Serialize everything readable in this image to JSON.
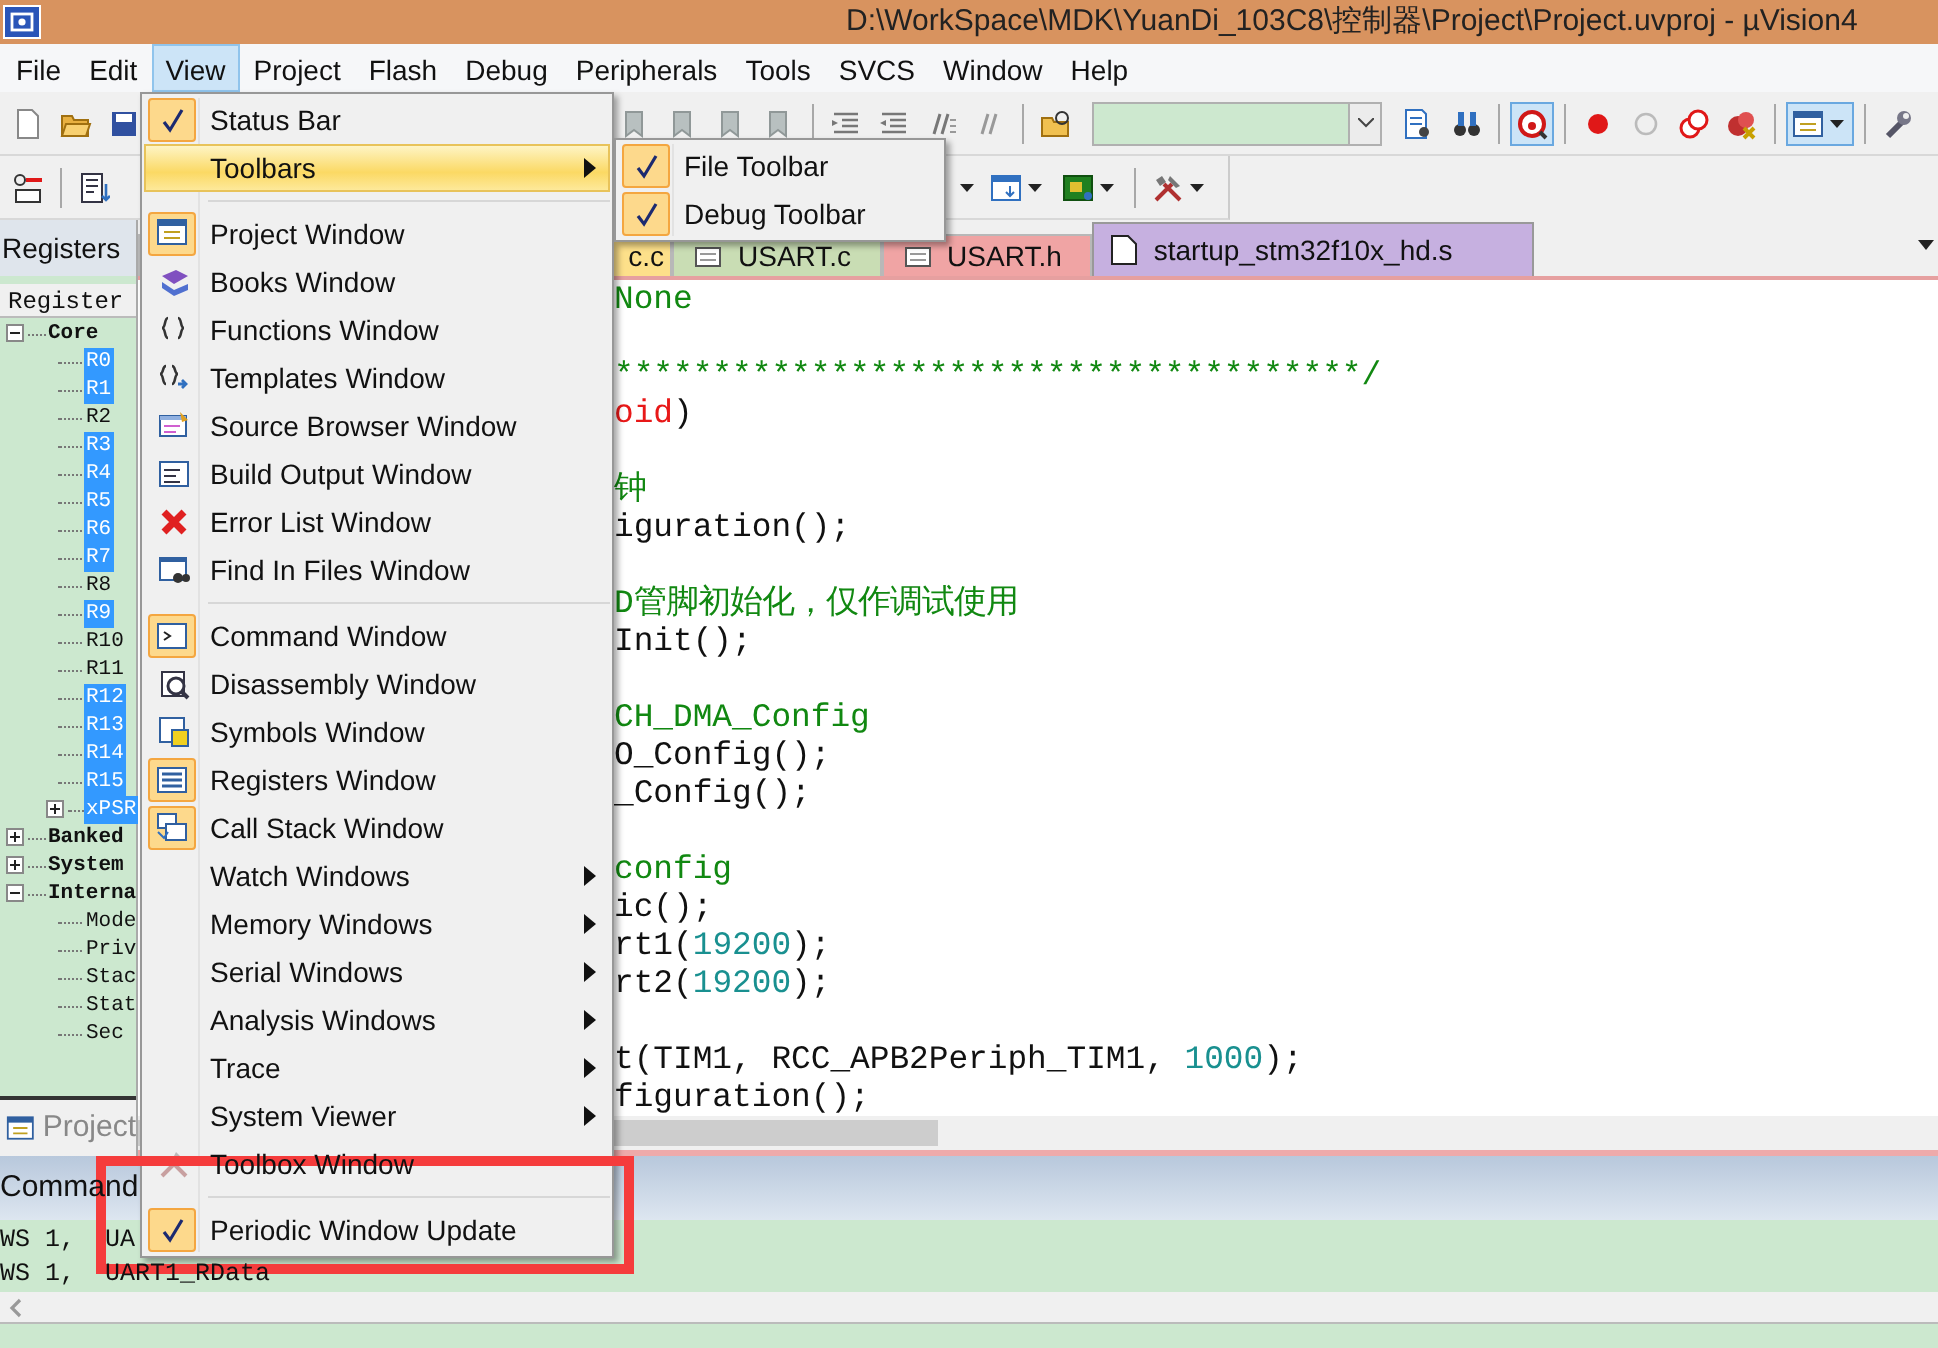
{
  "window": {
    "title": "D:\\WorkSpace\\MDK\\YuanDi_103C8\\控制器\\Project\\Project.uvproj - µVision4"
  },
  "menu_bar": [
    {
      "label": "File",
      "selected": false
    },
    {
      "label": "Edit",
      "selected": false
    },
    {
      "label": "View",
      "selected": true
    },
    {
      "label": "Project",
      "selected": false
    },
    {
      "label": "Flash",
      "selected": false
    },
    {
      "label": "Debug",
      "selected": false
    },
    {
      "label": "Peripherals",
      "selected": false
    },
    {
      "label": "Tools",
      "selected": false
    },
    {
      "label": "SVCS",
      "selected": false
    },
    {
      "label": "Window",
      "selected": false
    },
    {
      "label": "Help",
      "selected": false
    }
  ],
  "toolbars": [
    {
      "buttons": [
        {
          "pressed": false
        },
        {
          "pressed": false
        },
        {
          "pressed": false
        },
        {
          "pressed": false
        },
        {
          "pressed": false
        },
        {
          "pressed": false
        },
        {
          "pressed": false
        },
        {
          "pressed": false
        },
        {
          "pressed": false
        },
        {
          "pressed": false
        },
        {
          "pressed": false
        },
        {
          "pressed": false
        },
        {
          "pressed": false
        },
        {
          "pressed": false
        },
        {
          "pressed": true
        },
        {
          "pressed": false
        },
        {
          "pressed": false
        },
        {
          "pressed": false
        },
        {
          "pressed": false
        },
        {
          "pressed": true
        },
        {
          "pressed": false
        }
      ]
    },
    {
      "buttons": [
        {
          "pressed": false
        },
        {
          "pressed": false
        },
        {
          "pressed": false
        },
        {
          "pressed": false
        },
        {
          "pressed": false
        },
        {
          "pressed": false
        }
      ]
    }
  ],
  "registers_panel": {
    "title": "Registers",
    "column": "Register",
    "tree": [
      {
        "label": "Core",
        "expanded": true,
        "selected": false,
        "children": [
          {
            "label": "R0",
            "selected": true
          },
          {
            "label": "R1",
            "selected": true
          },
          {
            "label": "R2",
            "selected": false
          },
          {
            "label": "R3",
            "selected": true
          },
          {
            "label": "R4",
            "selected": true
          },
          {
            "label": "R5",
            "selected": true
          },
          {
            "label": "R6",
            "selected": true
          },
          {
            "label": "R7",
            "selected": true
          },
          {
            "label": "R8",
            "selected": false
          },
          {
            "label": "R9",
            "selected": true
          },
          {
            "label": "R10",
            "selected": false
          },
          {
            "label": "R11",
            "selected": false
          },
          {
            "label": "R12",
            "selected": true
          },
          {
            "label": "R13",
            "selected": true
          },
          {
            "label": "R14",
            "selected": true
          },
          {
            "label": "R15",
            "selected": true
          },
          {
            "label": "xPSR",
            "selected": true,
            "expanded": false
          }
        ]
      },
      {
        "label": "Banked",
        "expanded": false,
        "selected": false
      },
      {
        "label": "System",
        "expanded": false,
        "selected": false
      },
      {
        "label": "Interna",
        "expanded": true,
        "selected": false,
        "children": [
          {
            "label": "Mode",
            "selected": false
          },
          {
            "label": "Priv",
            "selected": false
          },
          {
            "label": "Stac",
            "selected": false
          },
          {
            "label": "Stat",
            "selected": false
          },
          {
            "label": "Sec",
            "selected": false
          }
        ]
      }
    ],
    "bottom_tab": "Project"
  },
  "editor_tabs": [
    {
      "label": "c.c",
      "color": "#fde08a",
      "selected": false
    },
    {
      "label": "USART.c",
      "color": "#c9ddb4",
      "selected": false
    },
    {
      "label": "USART.h",
      "color": "#f0a4a4",
      "selected": false
    },
    {
      "label": "startup_stm32f10x_hd.s",
      "color": "#c6b0e0",
      "selected": true
    }
  ],
  "code_lines": [
    {
      "blank_before": false,
      "segments": [
        {
          "text": "None",
          "kind": "comment"
        }
      ]
    },
    {
      "blank_before": true,
      "segments": [
        {
          "text": "**************************************/",
          "kind": "comment"
        }
      ]
    },
    {
      "blank_before": false,
      "segments": [
        {
          "text": "oid",
          "kind": "keyword"
        },
        {
          "text": ")",
          "kind": "plain"
        }
      ]
    },
    {
      "blank_before": true,
      "segments": [
        {
          "text": "钟",
          "kind": "comment"
        }
      ]
    },
    {
      "blank_before": false,
      "segments": [
        {
          "text": "iguration();",
          "kind": "plain"
        }
      ]
    },
    {
      "blank_before": true,
      "segments": [
        {
          "text": "D管脚初始化，仅作调试使用",
          "kind": "comment"
        }
      ]
    },
    {
      "blank_before": false,
      "segments": [
        {
          "text": "Init();",
          "kind": "plain"
        }
      ]
    },
    {
      "blank_before": true,
      "segments": [
        {
          "text": "CH_DMA_Config",
          "kind": "comment"
        }
      ]
    },
    {
      "blank_before": false,
      "segments": [
        {
          "text": "O_Config();",
          "kind": "plain"
        }
      ]
    },
    {
      "blank_before": false,
      "segments": [
        {
          "text": "_Config();",
          "kind": "plain"
        }
      ]
    },
    {
      "blank_before": true,
      "segments": [
        {
          "text": "config",
          "kind": "comment"
        }
      ]
    },
    {
      "blank_before": false,
      "segments": [
        {
          "text": "ic();",
          "kind": "plain"
        }
      ]
    },
    {
      "blank_before": false,
      "segments": [
        {
          "text": "rt1(",
          "kind": "plain"
        },
        {
          "text": "19200",
          "kind": "number"
        },
        {
          "text": ");",
          "kind": "plain"
        }
      ]
    },
    {
      "blank_before": false,
      "segments": [
        {
          "text": "rt2(",
          "kind": "plain"
        },
        {
          "text": "19200",
          "kind": "number"
        },
        {
          "text": ");",
          "kind": "plain"
        }
      ]
    },
    {
      "blank_before": true,
      "segments": [
        {
          "text": "t(TIM1, RCC_APB2Periph_TIM1, ",
          "kind": "plain"
        },
        {
          "text": "1000",
          "kind": "number"
        },
        {
          "text": ");",
          "kind": "plain"
        }
      ]
    },
    {
      "blank_before": false,
      "segments": [
        {
          "text": "figuration();",
          "kind": "plain"
        }
      ]
    }
  ],
  "command_panel": {
    "title": "Command",
    "lines": [
      "WS 1,  UA",
      "WS 1,  UART1_RData"
    ]
  },
  "view_menu": [
    {
      "label": "Status Bar",
      "kind": "check",
      "checked": true,
      "selected": false
    },
    {
      "label": "Toolbars",
      "kind": "submenu",
      "selected": true
    },
    {
      "kind": "separator"
    },
    {
      "label": "Project Window",
      "kind": "icon",
      "active": true,
      "selected": false
    },
    {
      "label": "Books Window",
      "kind": "icon",
      "active": false,
      "selected": false
    },
    {
      "label": "Functions Window",
      "kind": "icon",
      "active": false,
      "selected": false
    },
    {
      "label": "Templates Window",
      "kind": "icon",
      "active": false,
      "selected": false
    },
    {
      "label": "Source Browser Window",
      "kind": "icon",
      "active": false,
      "selected": false
    },
    {
      "label": "Build Output Window",
      "kind": "icon",
      "active": false,
      "selected": false
    },
    {
      "label": "Error List Window",
      "kind": "icon",
      "active": false,
      "selected": false
    },
    {
      "label": "Find In Files Window",
      "kind": "icon",
      "active": false,
      "selected": false
    },
    {
      "kind": "separator"
    },
    {
      "label": "Command Window",
      "kind": "icon",
      "active": true,
      "selected": false
    },
    {
      "label": "Disassembly Window",
      "kind": "icon",
      "active": false,
      "selected": false
    },
    {
      "label": "Symbols Window",
      "kind": "icon",
      "active": false,
      "selected": false
    },
    {
      "label": "Registers Window",
      "kind": "icon",
      "active": true,
      "selected": false
    },
    {
      "label": "Call Stack Window",
      "kind": "icon",
      "active": true,
      "selected": false
    },
    {
      "label": "Watch Windows",
      "kind": "submenu",
      "selected": false
    },
    {
      "label": "Memory Windows",
      "kind": "submenu",
      "selected": false
    },
    {
      "label": "Serial Windows",
      "kind": "submenu",
      "selected": false
    },
    {
      "label": "Analysis Windows",
      "kind": "submenu",
      "selected": false
    },
    {
      "label": "Trace",
      "kind": "submenu",
      "selected": false
    },
    {
      "label": "System Viewer",
      "kind": "submenu",
      "selected": false
    },
    {
      "label": "Toolbox Window",
      "kind": "icon",
      "active": false,
      "selected": false
    },
    {
      "kind": "separator"
    },
    {
      "label": "Periodic Window Update",
      "kind": "check",
      "checked": true,
      "selected": false
    }
  ],
  "toolbars_submenu": [
    {
      "label": "File Toolbar",
      "checked": true,
      "selected": false
    },
    {
      "label": "Debug Toolbar",
      "checked": true,
      "selected": false
    }
  ],
  "annotations": [
    {
      "kind": "highlight-box",
      "color": "#f53c3c"
    }
  ]
}
